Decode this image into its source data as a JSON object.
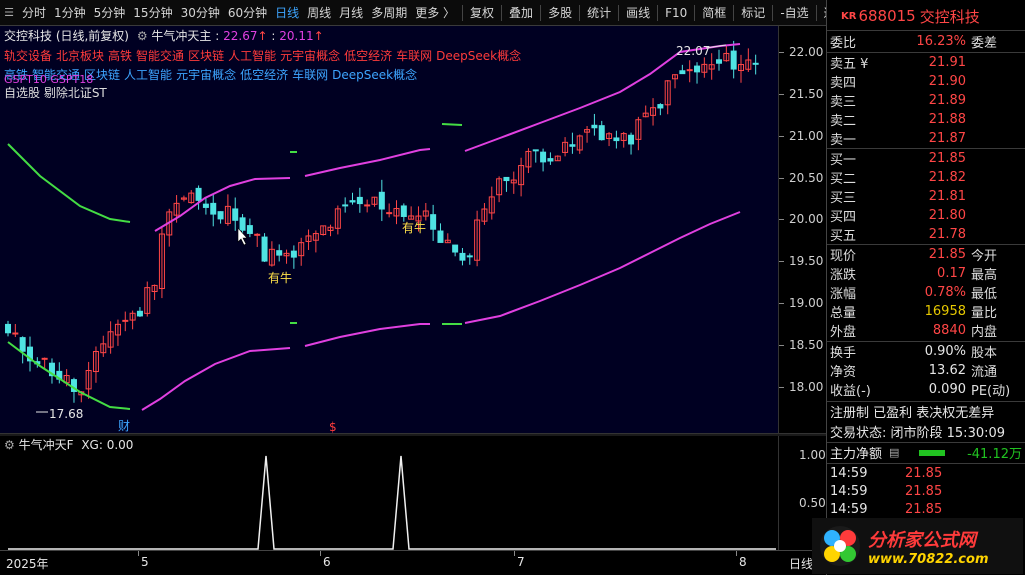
{
  "toolbar": {
    "periods": [
      "分时",
      "1分钟",
      "5分钟",
      "15分钟",
      "30分钟",
      "60分钟",
      "日线",
      "周线",
      "月线",
      "多周期",
      "更多 〉"
    ],
    "active_period": "日线",
    "tools": [
      "复权",
      "叠加",
      "多股",
      "统计",
      "画线",
      "F10",
      "简框",
      "标记",
      "-自选",
      "返回"
    ]
  },
  "main_chart": {
    "title": "交控科技 (日线,前复权)",
    "indicator_name": "牛气冲天主",
    "indicator_v1": "22.67",
    "indicator_v2": "20.11",
    "tags_line1": [
      "轨交设备",
      "北京板块",
      "高铁",
      "智能交通",
      "区块链",
      "人工智能",
      "元宇宙概念",
      "低空经济",
      "车联网",
      "DeepSeek概念"
    ],
    "tags_line2": [
      "高铁",
      "智能交通",
      "区块链",
      "人工智能",
      "元宇宙概念",
      "低空经济",
      "车联网",
      "DeepSeek概念"
    ],
    "tags_line3": "自选股 剔除北证ST",
    "overlay_text": "GSPT10  GSPT18",
    "signal_label": "有牛",
    "high_mark": "22.07",
    "low_mark": "17.68",
    "event_cai": "财",
    "event_s": "$"
  },
  "sub_chart": {
    "title": "牛气冲天F",
    "xg_label": "XG: 0.00"
  },
  "axes": {
    "main_ticks": [
      "22.00",
      "21.50",
      "21.00",
      "20.50",
      "20.00",
      "19.50",
      "19.00",
      "18.50",
      "18.00"
    ],
    "sub_ticks": [
      "1.00",
      "0.50"
    ],
    "x_labels": [
      "2025年",
      "5",
      "6",
      "7",
      "8"
    ],
    "period_label": "日线"
  },
  "quote": {
    "badge": "KR",
    "code": "688015",
    "name": "交控科技",
    "weibi_label": "委比",
    "weibi": "16.23%",
    "weicha_label": "委差",
    "asks": [
      {
        "label": "卖五 ¥",
        "price": "21.91"
      },
      {
        "label": "卖四",
        "price": "21.90"
      },
      {
        "label": "卖三",
        "price": "21.89"
      },
      {
        "label": "卖二",
        "price": "21.88"
      },
      {
        "label": "卖一",
        "price": "21.87"
      }
    ],
    "bids": [
      {
        "label": "买一",
        "price": "21.85"
      },
      {
        "label": "买二",
        "price": "21.82"
      },
      {
        "label": "买三",
        "price": "21.81"
      },
      {
        "label": "买四",
        "price": "21.80"
      },
      {
        "label": "买五",
        "price": "21.78"
      }
    ],
    "stats": [
      {
        "label": "现价",
        "value": "21.85",
        "rlabel": "今开",
        "cls": "red"
      },
      {
        "label": "涨跌",
        "value": "0.17",
        "rlabel": "最高",
        "cls": "red"
      },
      {
        "label": "涨幅",
        "value": "0.78%",
        "rlabel": "最低",
        "cls": "red"
      },
      {
        "label": "总量",
        "value": "16958",
        "rlabel": "量比",
        "cls": "yellow"
      },
      {
        "label": "外盘",
        "value": "8840",
        "rlabel": "内盘",
        "cls": "red"
      }
    ],
    "stats2": [
      {
        "label": "换手",
        "value": "0.90%",
        "rlabel": "股本"
      },
      {
        "label": "净资",
        "value": "13.62",
        "rlabel": "流通"
      },
      {
        "label": "收益(-)",
        "value": "0.090",
        "rlabel": "PE(动)"
      }
    ],
    "info_line": "注册制 已盈利 表决权无差异",
    "status_line": "交易状态: 闭市阶段 15:30:09",
    "main_flow_label": "主力净额",
    "main_flow_value": "-41.12万",
    "ticks": [
      {
        "time": "14:59",
        "price": "21.85"
      },
      {
        "time": "14:59",
        "price": "21.85"
      },
      {
        "time": "14:59",
        "price": "21.85"
      }
    ]
  },
  "logo": {
    "title": "分析家公式网",
    "url": "www.70822.com"
  },
  "colors": {
    "up": "#ff4646",
    "down": "#4fe3e3",
    "band_magenta": "#e040e0",
    "band_green": "#44dd44",
    "accent_blue": "#3da5ff"
  }
}
